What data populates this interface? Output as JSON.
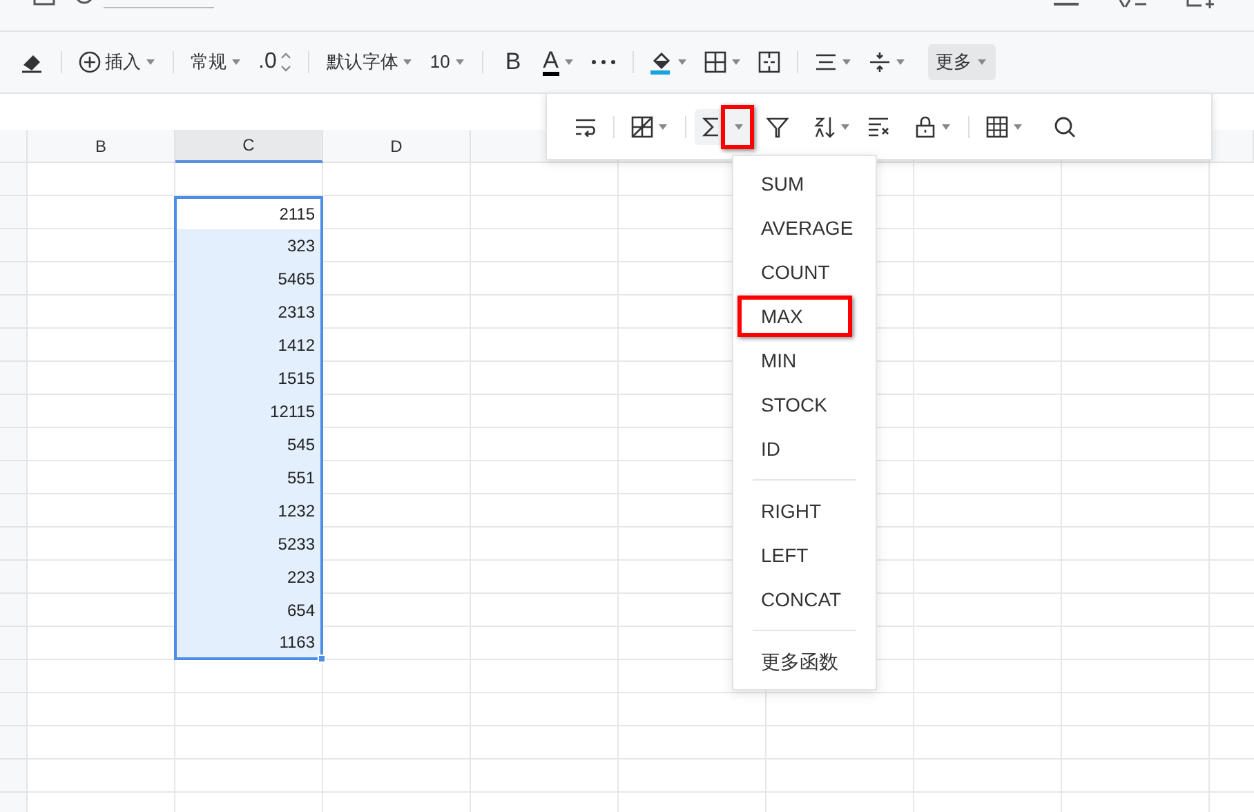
{
  "toolbar": {
    "insert": "插入",
    "format": "常规",
    "decimal": ".0",
    "font": "默认字体",
    "size": "10",
    "bold": "B",
    "font_color": "A",
    "more": {
      "label": "更多",
      "pressed": true
    }
  },
  "popup_toolbar": {
    "sum_caret_highlighted": true
  },
  "columns": [
    {
      "label": "B",
      "selected": false
    },
    {
      "label": "C",
      "selected": true
    },
    {
      "label": "D",
      "selected": false
    }
  ],
  "cells": [
    {
      "value": "2115",
      "active": true
    },
    {
      "value": "323",
      "active": false
    },
    {
      "value": "5465",
      "active": false
    },
    {
      "value": "2313",
      "active": false
    },
    {
      "value": "1412",
      "active": false
    },
    {
      "value": "1515",
      "active": false
    },
    {
      "value": "12115",
      "active": false
    },
    {
      "value": "545",
      "active": false
    },
    {
      "value": "551",
      "active": false
    },
    {
      "value": "1232",
      "active": false
    },
    {
      "value": "5233",
      "active": false
    },
    {
      "value": "223",
      "active": false
    },
    {
      "value": "654",
      "active": false
    },
    {
      "value": "1163",
      "active": false
    }
  ],
  "function_menu": {
    "groups": [
      [
        {
          "label": "SUM",
          "highlighted": false
        },
        {
          "label": "AVERAGE",
          "highlighted": false
        },
        {
          "label": "COUNT",
          "highlighted": false
        },
        {
          "label": "MAX",
          "highlighted": true
        },
        {
          "label": "MIN",
          "highlighted": false
        },
        {
          "label": "STOCK",
          "highlighted": false
        },
        {
          "label": "ID",
          "highlighted": false
        }
      ],
      [
        {
          "label": "RIGHT",
          "highlighted": false
        },
        {
          "label": "LEFT",
          "highlighted": false
        },
        {
          "label": "CONCAT",
          "highlighted": false
        }
      ],
      [
        {
          "label": "更多函数",
          "highlighted": false
        }
      ]
    ]
  }
}
